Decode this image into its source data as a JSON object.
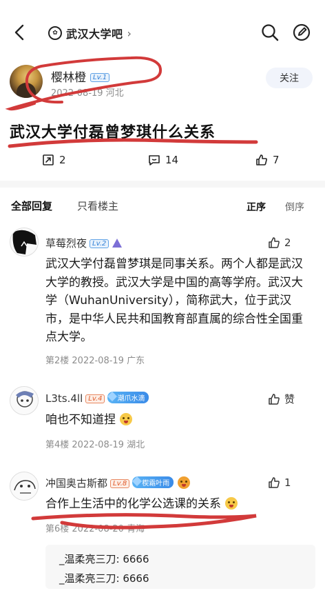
{
  "nav": {
    "back_icon": "back-arrow-icon",
    "forum_name": "武汉大学吧",
    "forum_chevron": "›",
    "search_icon": "search-icon",
    "edit_icon": "edit-icon"
  },
  "post": {
    "author": "樱林橙",
    "author_level": "Lv.1",
    "date": "2022-08-19",
    "location": "河北",
    "date_line": "2022-08-19   河北",
    "follow_label": "关注",
    "title": "武汉大学付磊曾梦琪什么关系",
    "share_count": "2",
    "comment_count": "14",
    "like_count": "7"
  },
  "tabs": {
    "all": "全部回复",
    "owner_only": "只看楼主",
    "asc": "正序",
    "desc": "倒序"
  },
  "replies": [
    {
      "name": "草莓烈夜",
      "level": "Lv.2",
      "likes": "2",
      "text": "武汉大学付磊曾梦琪是同事关系。两个人都是武汉大学的教授。武汉大学是中国的高等学府。武汉大学（WuhanUniversity），简称武大，位于武汉市，是中华人民共和国教育部直属的综合性全国重点大学。",
      "meta": "第2楼  2022-08-19  广东"
    },
    {
      "name": "L3ts.4ll",
      "level": "Lv.4",
      "badge": "潮爪水滴",
      "likes": "赞",
      "text": "咱也不知道捏",
      "meta": "第4楼  2022-08-19  湖北"
    },
    {
      "name": "冲国奥古斯都",
      "level": "Lv.8",
      "badge": "楔霜叶雨",
      "likes": "1",
      "text": "合作上生活中的化学公选课的关系",
      "meta": "第6楼  2022-08-20  青海"
    }
  ],
  "subreplies": [
    "_温柔亮三刀: 6666",
    "_温柔亮三刀: 6666"
  ],
  "colors": {
    "annotation_red": "#d23a3a",
    "level_blue": "#2f7fd6",
    "level_orange": "#e05b2b"
  }
}
